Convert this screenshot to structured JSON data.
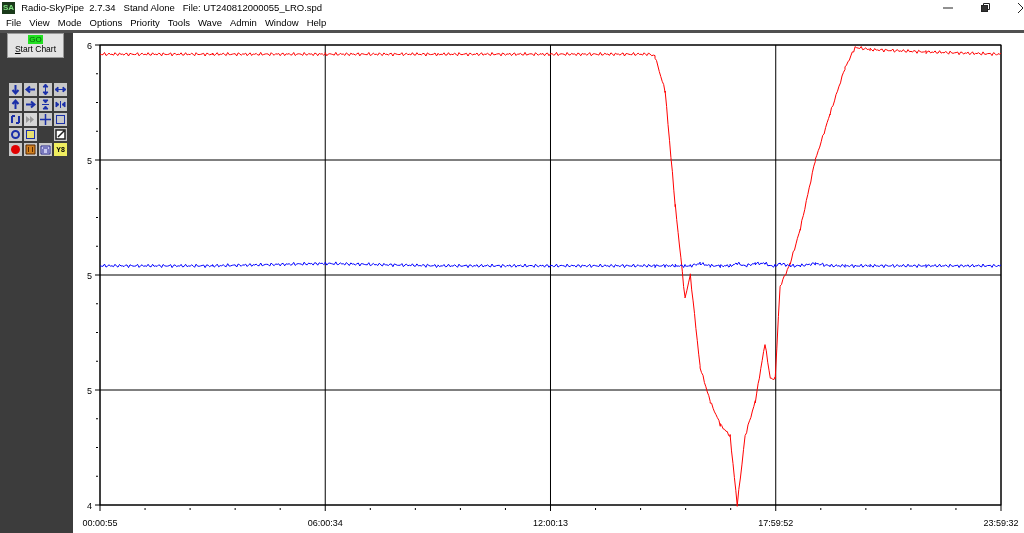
{
  "window": {
    "app_icon": "SA",
    "title": "Radio-SkyPipe  2.7.34   Stand Alone   File: UT240812000055_LRO.spd"
  },
  "menu": [
    "File",
    "View",
    "Mode",
    "Options",
    "Priority",
    "Tools",
    "Wave",
    "Admin",
    "Window",
    "Help"
  ],
  "toolbar": {
    "start_button": {
      "label": "Start Chart",
      "indicator": "GO"
    },
    "y_button": "Y8"
  },
  "chart_data": {
    "type": "line",
    "grid": true,
    "xlim": [
      55,
      86372
    ],
    "ylim": [
      4,
      6
    ],
    "xticks": [
      {
        "value": 55,
        "label": "00:00:55"
      },
      {
        "value": 21634,
        "label": "06:00:34"
      },
      {
        "value": 43213,
        "label": "12:00:13"
      },
      {
        "value": 64792,
        "label": "17:59:52"
      },
      {
        "value": 86372,
        "label": "23:59:32"
      }
    ],
    "yticks": [
      {
        "value": 4,
        "label": "4"
      },
      {
        "value": 4.5,
        "label": "5"
      },
      {
        "value": 5,
        "label": "5"
      },
      {
        "value": 5.5,
        "label": "5"
      },
      {
        "value": 6,
        "label": "6"
      }
    ],
    "x": [
      55,
      10847,
      21634,
      32432,
      43213,
      52758,
      53225,
      54196,
      55167,
      56103,
      56606,
      57542,
      58513,
      59484,
      60420,
      61103,
      61859,
      62830,
      63766,
      64270,
      64737,
      65205,
      66176,
      67147,
      68586,
      69989,
      71428,
      72399,
      73838,
      79198,
      86372
    ],
    "series": [
      {
        "color": "#ff0000",
        "values": [
          5.96,
          5.96,
          5.96,
          5.96,
          5.96,
          5.96,
          5.95,
          5.8,
          5.3,
          4.9,
          5.0,
          4.6,
          4.45,
          4.35,
          4.3,
          4.0,
          4.3,
          4.45,
          4.7,
          4.55,
          4.55,
          4.95,
          5.05,
          5.2,
          5.5,
          5.7,
          5.9,
          5.99,
          5.98,
          5.97,
          5.96
        ]
      },
      {
        "color": "#0000ff",
        "values": [
          5.04,
          5.04,
          5.05,
          5.04,
          5.04,
          5.04,
          5.04,
          5.04,
          5.04,
          5.04,
          5.04,
          5.05,
          5.04,
          5.04,
          5.04,
          5.05,
          5.04,
          5.05,
          5.05,
          5.04,
          5.04,
          5.05,
          5.04,
          5.04,
          5.05,
          5.04,
          5.04,
          5.04,
          5.04,
          5.04,
          5.04
        ]
      }
    ]
  }
}
